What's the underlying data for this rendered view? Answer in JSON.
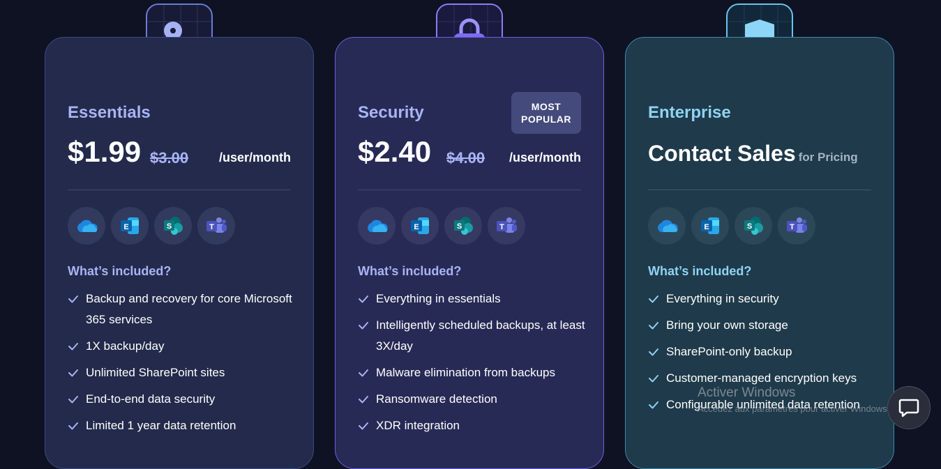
{
  "plans": [
    {
      "icon": "key-icon",
      "name": "Essentials",
      "price": "$1.99",
      "old_price": "$3.00",
      "per": "/user/month",
      "included_label": "What’s included?",
      "features": [
        "Backup and recovery for core Microsoft 365 services",
        "1X backup/day",
        "Unlimited SharePoint sites",
        "End-to-end data security",
        "Limited 1 year data retention"
      ]
    },
    {
      "icon": "lock-icon",
      "name": "Security",
      "badge": "MOST POPULAR",
      "price": "$2.40",
      "old_price": "$4.00",
      "per": "/user/month",
      "included_label": "What’s included?",
      "features": [
        "Everything in essentials",
        "Intelligently scheduled backups, at least 3X/day",
        "Malware elimination from backups",
        "Ransomware detection",
        "XDR integration"
      ]
    },
    {
      "icon": "shield-icon",
      "name": "Enterprise",
      "contact": "Contact Sales",
      "contact_suffix": "for Pricing",
      "included_label": "What’s included?",
      "features": [
        "Everything in security",
        "Bring your own storage",
        "SharePoint-only backup",
        "Customer-managed encryption keys",
        "Configurable unlimited data retention"
      ]
    }
  ],
  "apps": [
    "onedrive-icon",
    "exchange-icon",
    "sharepoint-icon",
    "teams-icon"
  ],
  "watermark": {
    "title": "Activer Windows",
    "subtitle": "Accédez aux paramètres pour activer Windows."
  },
  "colors": {
    "background": "#0f1222",
    "essentials_accent": "#a9b4f3",
    "security_border": "#6d5fe0",
    "enterprise_accent": "#8fd3f3"
  }
}
